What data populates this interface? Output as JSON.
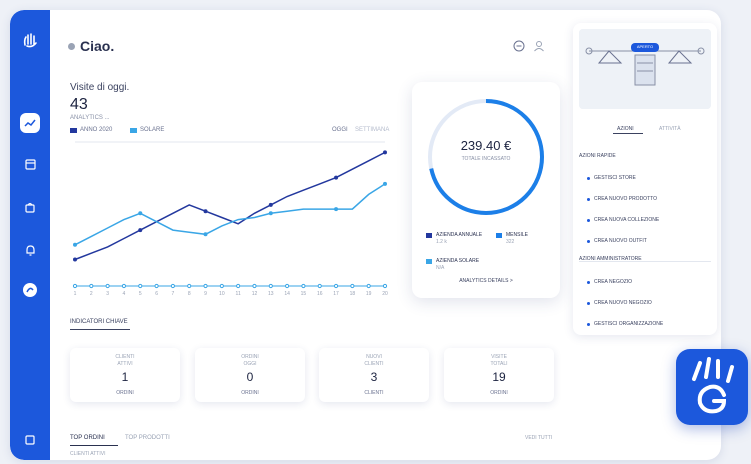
{
  "header": {
    "greeting": "Ciao."
  },
  "visits": {
    "label": "Visite di oggi.",
    "value": "43",
    "sublabel": "ANALYTICS ..."
  },
  "chart_legend": {
    "series1": "ANNO 2020",
    "series2": "SOLARE",
    "right1": "OGGI",
    "right2": "SETTIMANA"
  },
  "chart_data": {
    "type": "line",
    "x": [
      "1",
      "2",
      "3",
      "4",
      "5",
      "6",
      "7",
      "8",
      "9",
      "10",
      "11",
      "12",
      "13",
      "14",
      "15",
      "16",
      "17",
      "18",
      "19",
      "20"
    ],
    "series": [
      {
        "name": "ANNO 2020",
        "values": [
          5,
          8,
          11,
          15,
          19,
          23,
          27,
          31,
          28,
          25,
          22,
          27,
          31,
          35,
          38,
          41,
          44,
          48,
          52,
          56
        ]
      },
      {
        "name": "SOLARE",
        "values": [
          12,
          16,
          20,
          24,
          27,
          23,
          19,
          18,
          17,
          21,
          24,
          25,
          27,
          28,
          29,
          29,
          29,
          29,
          36,
          41
        ]
      }
    ],
    "ylim": [
      0,
      60
    ]
  },
  "total_card": {
    "amount": "239.40 €",
    "amount_label": "TOTALE INCASSATO",
    "legend": [
      {
        "label": "AZIENDA ANNUALE",
        "sub": "1.2 k",
        "color": "#23389e"
      },
      {
        "label": "MENSILE",
        "sub": "322",
        "color": "#1c7fe8"
      },
      {
        "label": "AZIENDA SOLARE",
        "sub": "N/A",
        "color": "#3aa6e6"
      }
    ],
    "link": "ANALYTICS DETAILS >"
  },
  "section": {
    "title": "INDICATORI CHIAVE"
  },
  "stats": [
    {
      "label1": "CLIENTI",
      "label2": "ATTIVI",
      "value": "1",
      "sub": "ORDINI"
    },
    {
      "label1": "ORDINI",
      "label2": "OGGI",
      "value": "0",
      "sub": "ORDINI"
    },
    {
      "label1": "NUOVI",
      "label2": "CLIENTI",
      "value": "3",
      "sub": "CLIENTI"
    },
    {
      "label1": "VISITE",
      "label2": "TOTALI",
      "value": "19",
      "sub": "ORDINI"
    }
  ],
  "bottom_tabs": {
    "tab1": "TOP ORDINI",
    "tab2": "TOP PRODOTTI",
    "hint": "CLIENTI ATTIVI",
    "right": "VEDI TUTTI"
  },
  "right_panel": {
    "badge": "APERTO",
    "tab1": "AZIONI",
    "tab2": "ATTIVITÀ",
    "head1": "AZIONI RAPIDE",
    "items1": [
      "GESTISCI STORE",
      "CREA NUOVO PRODOTTO",
      "CREA NUOVA COLLEZIONE",
      "CREA NUOVO OUTFIT"
    ],
    "head2": "AZIONI AMMINISTRATORE",
    "items2": [
      "CREA NEGOZIO",
      "CREA NUOVO NEGOZIO",
      "GESTISCI ORGANIZZAZIONE"
    ]
  },
  "colors": {
    "primary": "#1c58dc",
    "series_dark": "#23389e",
    "series_light": "#3aa6e6"
  }
}
